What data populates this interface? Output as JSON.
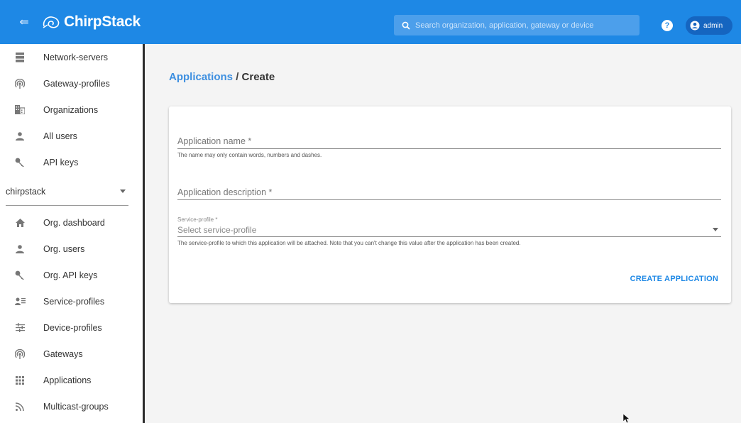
{
  "colors": {
    "primary": "#1e88e5",
    "link": "#3d8fe0",
    "primary_dark": "#1565c0"
  },
  "appbar": {
    "collapse_icon": "collapse-menu-icon",
    "logo_text": "ChirpStack",
    "search_placeholder": "Search organization, application, gateway or device",
    "help_icon": "help-icon",
    "user_label": "admin"
  },
  "sidebar": {
    "admin_items": [
      {
        "label": "Network-servers",
        "icon": "server-icon"
      },
      {
        "label": "Gateway-profiles",
        "icon": "wifi-tether-icon"
      },
      {
        "label": "Organizations",
        "icon": "domain-icon"
      },
      {
        "label": "All users",
        "icon": "person-icon"
      },
      {
        "label": "API keys",
        "icon": "key-icon"
      }
    ],
    "organization": "chirpstack",
    "org_items": [
      {
        "label": "Org. dashboard",
        "icon": "home-icon"
      },
      {
        "label": "Org. users",
        "icon": "person-icon"
      },
      {
        "label": "Org. API keys",
        "icon": "key-icon"
      },
      {
        "label": "Service-profiles",
        "icon": "account-details-icon"
      },
      {
        "label": "Device-profiles",
        "icon": "tune-icon"
      },
      {
        "label": "Gateways",
        "icon": "wifi-tether-icon"
      },
      {
        "label": "Applications",
        "icon": "apps-icon"
      },
      {
        "label": "Multicast-groups",
        "icon": "rss-icon"
      }
    ]
  },
  "breadcrumb": {
    "link": "Applications",
    "separator": "/",
    "current": "Create"
  },
  "form": {
    "name_label": "Application name *",
    "name_helper": "The name may only contain words, numbers and dashes.",
    "description_label": "Application description *",
    "service_profile_label": "Service-profile *",
    "service_profile_placeholder": "Select service-profile",
    "service_profile_helper": "The service-profile to which this application will be attached. Note that you can't change this value after the application has been created.",
    "submit_label": "CREATE APPLICATION"
  }
}
